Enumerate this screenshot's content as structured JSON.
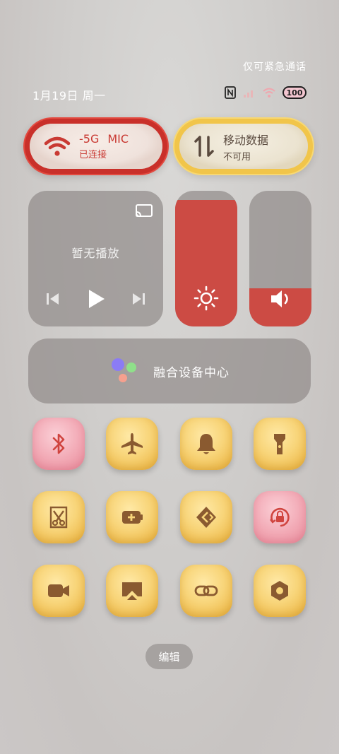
{
  "status": {
    "emergency_text": "仅可紧急通话",
    "date": "1月19日 周一",
    "battery": "100"
  },
  "wifi_pill": {
    "network_name_part1": "-5G",
    "network_name_part2": "MIC",
    "status": "已连接"
  },
  "data_pill": {
    "title": "移动数据",
    "status": "不可用"
  },
  "media": {
    "empty_text": "暂无播放"
  },
  "sliders": {
    "brightness_level": 0.93,
    "volume_level": 0.28
  },
  "device_center": {
    "label": "融合设备中心"
  },
  "tiles": [
    {
      "icon": "bluetooth-icon",
      "color": "pink",
      "active": true
    },
    {
      "icon": "airplane-icon",
      "color": "yellow",
      "active": false
    },
    {
      "icon": "bell-icon",
      "color": "yellow",
      "active": false
    },
    {
      "icon": "flashlight-icon",
      "color": "yellow",
      "active": false
    },
    {
      "icon": "screenshot-icon",
      "color": "yellow",
      "active": false
    },
    {
      "icon": "battery-saver-icon",
      "color": "yellow",
      "active": false
    },
    {
      "icon": "share-icon",
      "color": "yellow",
      "active": false
    },
    {
      "icon": "rotation-lock-icon",
      "color": "pink",
      "active": true
    },
    {
      "icon": "screen-record-icon",
      "color": "yellow",
      "active": false
    },
    {
      "icon": "screencast-icon",
      "color": "yellow",
      "active": false
    },
    {
      "icon": "link-icon",
      "color": "yellow",
      "active": false
    },
    {
      "icon": "settings-nut-icon",
      "color": "yellow",
      "active": false
    }
  ],
  "edit_label": "编辑",
  "colors": {
    "accent_red": "#cc4b44",
    "tile_yellow": "#f8d57a",
    "tile_pink": "#f2a9b5",
    "icon_brown": "#8a5a30"
  }
}
